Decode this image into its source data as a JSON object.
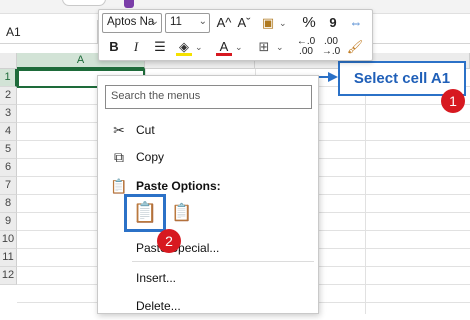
{
  "name_box": {
    "value": "A1"
  },
  "columns": [
    "A"
  ],
  "rows": [
    "1",
    "2",
    "3",
    "4",
    "5",
    "6",
    "7",
    "8",
    "9",
    "10",
    "11",
    "12"
  ],
  "mini_toolbar": {
    "font_name": "Aptos Na",
    "font_size": "11",
    "grow_label": "A^",
    "shrink_label": "Aˇ",
    "percent_label": "%",
    "comma_label": "9",
    "bold_label": "B",
    "italic_label": "I",
    "font_color_label": "A",
    "inc_decimal_label": "←.0 .00",
    "dec_decimal_label": ".00 →.0",
    "dropdown_glyph": "⌄",
    "highlight_color": "#f5e100",
    "font_color": "#d71920"
  },
  "callout": {
    "text": "Select cell A1",
    "badge": "1",
    "color": "#2b71c7",
    "badge_color": "#d71920"
  },
  "context_menu": {
    "search_placeholder": "Search the menus",
    "cut": "Cut",
    "copy": "Copy",
    "paste_options": "Paste Options:",
    "paste_special": "Paste Special...",
    "insert": "Insert...",
    "delete": "Delete...",
    "badge": "2"
  }
}
